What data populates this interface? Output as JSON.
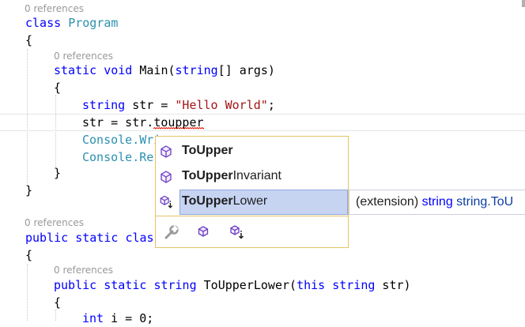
{
  "colors": {
    "keyword": "#0000ff",
    "type": "#2b91af",
    "string": "#a31515",
    "codelens": "#999999",
    "popup_border": "#e5c365",
    "selection": "#c6d4f2",
    "squiggle": "#e51400",
    "method_icon": "#6c3cc4"
  },
  "editor": {
    "codelens": [
      "0 references",
      "0 references",
      "0 references",
      "0 references"
    ],
    "code": {
      "class_kw": "class",
      "class_name": "Program",
      "open1": "{",
      "static1": "static",
      "void": "void",
      "main_sig": " Main(",
      "string_kw1": "string",
      "main_args": "[] args)",
      "open2": "{",
      "string_kw2": "string",
      "decl": " str = ",
      "hello": "\"Hello World\"",
      "semi": ";",
      "assign_prefix": "str = str.",
      "typed": "toupper",
      "console1": "Console",
      "writeline_visible": ".Wri",
      "console2": "Console",
      "read_visible": ".Re",
      "close2": "}",
      "close1": "}",
      "public1": "public",
      "static2": "static",
      "clas_visible": "clas",
      "open3": "{",
      "public2": "public",
      "static3": "static",
      "string_kw3": "string",
      "ext_method": " ToUpperLower(",
      "this_kw": "this",
      "string_kw4": "string",
      "ext_param": " str)",
      "open4": "{",
      "int_kw": "int",
      "int_rest": " i = 0;"
    }
  },
  "completion": {
    "items": [
      {
        "match": "ToUpper",
        "rest": "",
        "icon": "method-icon"
      },
      {
        "match": "ToUpper",
        "rest": "Invariant",
        "icon": "method-icon"
      },
      {
        "match": "ToUpper",
        "rest": "Lower",
        "icon": "extension-method-icon"
      }
    ],
    "selected_index": 2,
    "filters": [
      "wrench-filter-icon",
      "method-filter-icon",
      "extension-method-filter-icon"
    ]
  },
  "tooltip": {
    "prefix": "(extension) ",
    "type1": "string",
    "space": " ",
    "type2": "string.",
    "member_partial": "ToU"
  }
}
